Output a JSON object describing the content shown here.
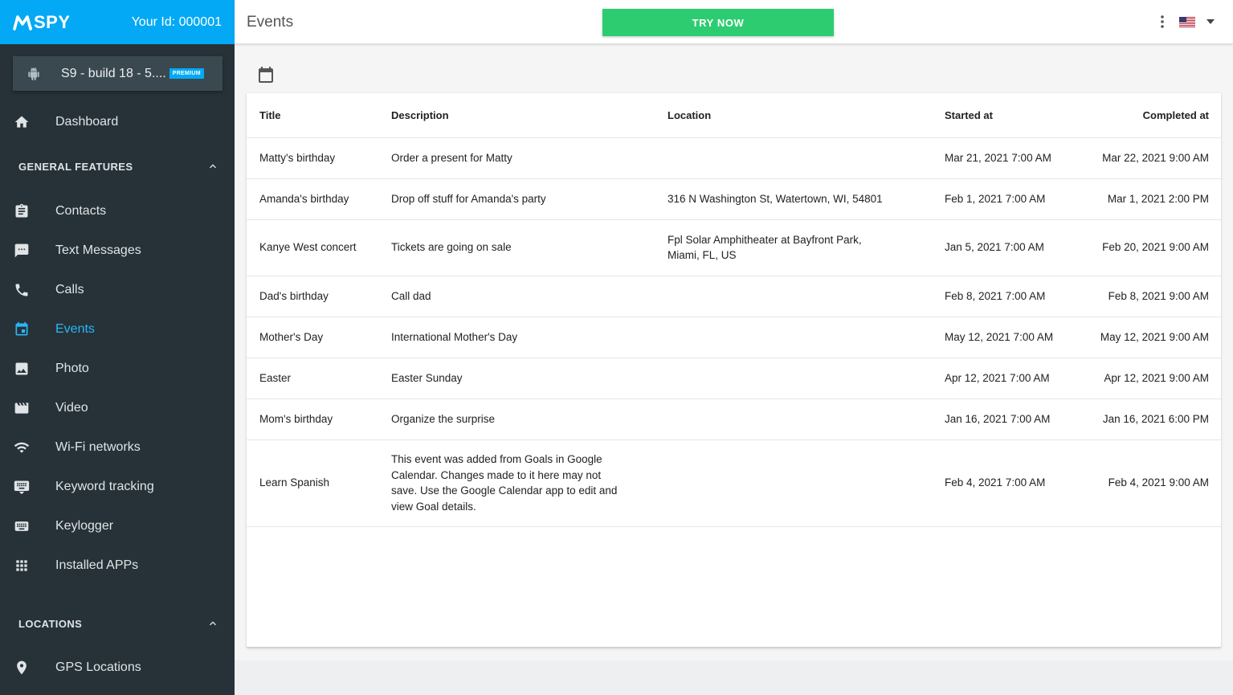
{
  "brand": {
    "logo_text": "SPY",
    "user_id": "Your Id: 000001",
    "color": "#03a9f4"
  },
  "device": {
    "name": "S9 - build 18 - 5....",
    "badge": "PREMIUM",
    "icon": "android-icon"
  },
  "nav": {
    "dashboard": "Dashboard",
    "sections": [
      {
        "label": "GENERAL FEATURES",
        "expanded": true
      },
      {
        "label": "LOCATIONS",
        "expanded": true
      }
    ],
    "items": [
      {
        "label": "Contacts",
        "icon": "contacts-icon"
      },
      {
        "label": "Text Messages",
        "icon": "chat-icon"
      },
      {
        "label": "Calls",
        "icon": "phone-icon"
      },
      {
        "label": "Events",
        "icon": "calendar-icon",
        "active": true
      },
      {
        "label": "Photo",
        "icon": "image-icon"
      },
      {
        "label": "Video",
        "icon": "video-icon"
      },
      {
        "label": "Wi-Fi networks",
        "icon": "wifi-icon"
      },
      {
        "label": "Keyword tracking",
        "icon": "keyword-icon"
      },
      {
        "label": "Keylogger",
        "icon": "keyboard-icon"
      },
      {
        "label": "Installed APPs",
        "icon": "apps-icon"
      }
    ],
    "gps": "GPS Locations"
  },
  "header": {
    "title": "Events",
    "try_now": "TRY NOW",
    "accent": "#2ecc71"
  },
  "table": {
    "columns": [
      "Title",
      "Description",
      "Location",
      "Started at",
      "Completed at"
    ],
    "rows": [
      [
        "Matty's birthday",
        "Order a present for Matty",
        "",
        "Mar 21, 2021 7:00 AM",
        "Mar 22, 2021 9:00 AM"
      ],
      [
        "Amanda's birthday",
        "Drop off stuff for Amanda's party",
        "316 N Washington St, Watertown, WI, 54801",
        "Feb 1, 2021 7:00 AM",
        "Mar 1, 2021 2:00 PM"
      ],
      [
        "Kanye West concert",
        "Tickets are going on sale",
        "Fpl Solar Amphitheater at Bayfront Park, Miami, FL, US",
        "Jan 5, 2021 7:00 AM",
        "Feb 20, 2021 9:00 AM"
      ],
      [
        "Dad's birthday",
        "Call dad",
        "",
        "Feb 8, 2021 7:00 AM",
        "Feb 8, 2021 9:00 AM"
      ],
      [
        "Mother's Day",
        "International Mother's Day",
        "",
        "May 12, 2021 7:00 AM",
        "May 12, 2021 9:00 AM"
      ],
      [
        "Easter",
        "Easter Sunday",
        "",
        "Apr 12, 2021 7:00 AM",
        "Apr 12, 2021 9:00 AM"
      ],
      [
        "Mom's birthday",
        "Organize the surprise",
        "",
        "Jan 16, 2021 7:00 AM",
        "Jan 16, 2021 6:00 PM"
      ],
      [
        "Learn Spanish",
        "This event was added from Goals in Google Calendar. Changes made to it here may not save. Use the Google Calendar app to edit and view Goal details.",
        "",
        "Feb 4, 2021 7:00 AM",
        "Feb 4, 2021 9:00 AM"
      ]
    ]
  }
}
